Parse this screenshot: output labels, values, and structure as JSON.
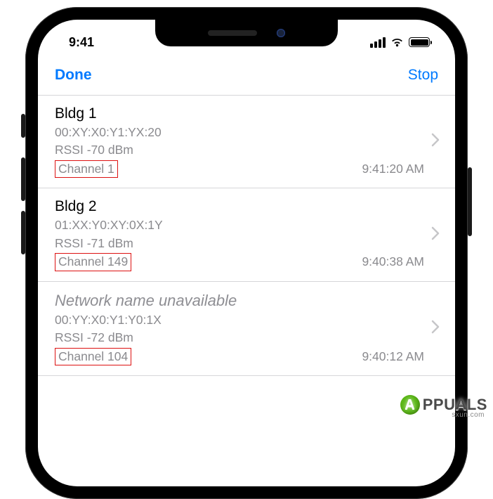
{
  "status": {
    "time": "9:41"
  },
  "nav": {
    "done": "Done",
    "stop": "Stop"
  },
  "networks": [
    {
      "name": "Bldg 1",
      "unavailable": false,
      "bssid": "00:XY:X0:Y1:YX:20",
      "rssi": "RSSI -70 dBm",
      "channel": "Channel 1",
      "timestamp": "9:41:20 AM"
    },
    {
      "name": "Bldg 2",
      "unavailable": false,
      "bssid": "01:XX:Y0:XY:0X:1Y",
      "rssi": "RSSI -71 dBm",
      "channel": "Channel 149",
      "timestamp": "9:40:38 AM"
    },
    {
      "name": "Network name unavailable",
      "unavailable": true,
      "bssid": "00:YY:X0:Y1:Y0:1X",
      "rssi": "RSSI -72 dBm",
      "channel": "Channel 104",
      "timestamp": "9:40:12 AM"
    }
  ],
  "watermark": {
    "brand_prefix": "A",
    "brand_suffix": "PPUALS",
    "site": "sxun.com"
  }
}
